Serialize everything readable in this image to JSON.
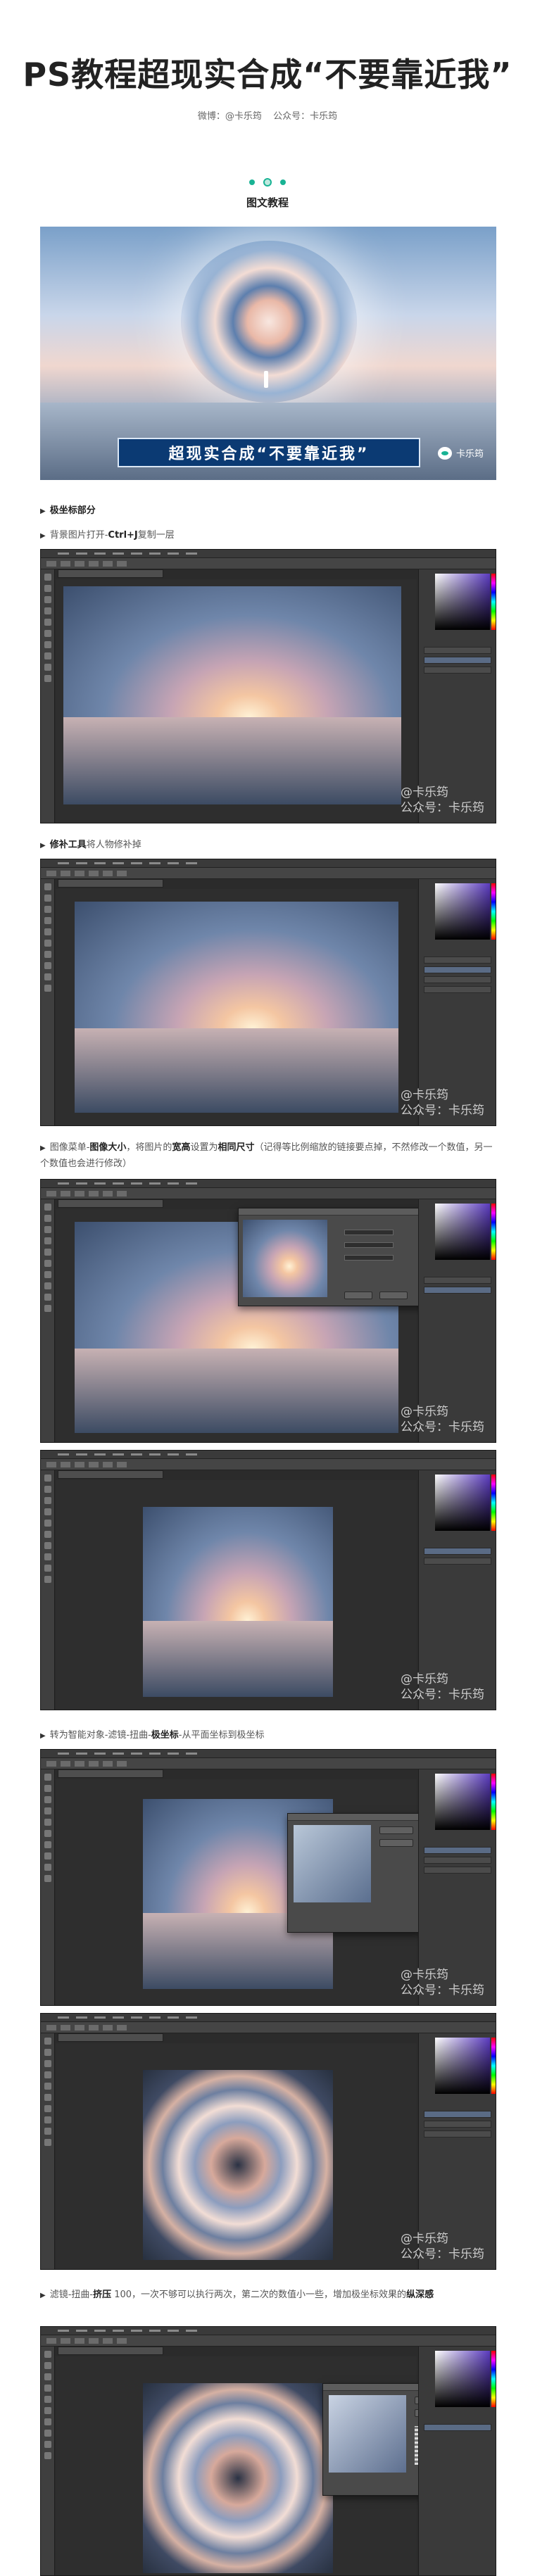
{
  "header": {
    "title": "PS教程超现实合成“不要靠近我”",
    "weibo": "微博：@卡乐筠",
    "official": "公众号：卡乐筠"
  },
  "section": {
    "title": "图文教程"
  },
  "hero": {
    "banner_text": "超现实合成“不要靠近我”",
    "watermark": "卡乐筠",
    "icon": "wechat-icon"
  },
  "steps": [
    {
      "text": "极坐标部分"
    },
    {
      "prefix": "背景图片打开-",
      "key": "Ctrl+J",
      "suffix": "复制一层"
    },
    {
      "key": "修补工具",
      "suffix": "将人物修补掉"
    },
    {
      "prefix": "图像菜单-",
      "key": "图像大小",
      "mid": "，将图片的",
      "key2": "宽高",
      "mid2": "设置为",
      "key3": "相同尺寸",
      "suffix": "（记得等比例缩放的链接要点掉，不然修改一个数值，另一个数值也会进行修改）"
    },
    {
      "prefix": "转为智能对象-滤镜-扭曲-",
      "key": "极坐标",
      "suffix": "-从平面坐标到极坐标"
    },
    {
      "prefix": "滤镜-扭曲-",
      "key": "挤压",
      "suffix": " 100，一次不够可以执行两次，第二次的数值小一些，增加极坐标效果的",
      "key2": "纵深感"
    }
  ],
  "watermark": {
    "line1": "@卡乐筠",
    "line2": "公众号：卡乐筠"
  },
  "colors": {
    "accent": "#19b394",
    "ps_bg": "#2b2b2b",
    "banner": "#0b3a73"
  }
}
